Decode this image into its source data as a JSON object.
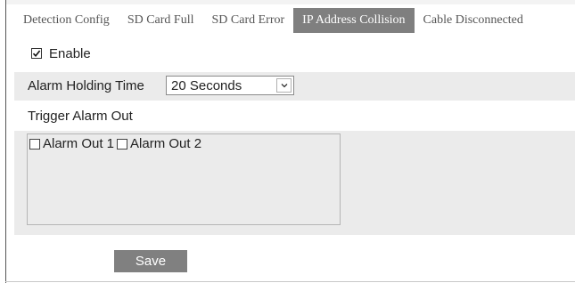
{
  "tabs": [
    {
      "label": "Detection Config",
      "active": false
    },
    {
      "label": "SD Card Full",
      "active": false
    },
    {
      "label": "SD Card Error",
      "active": false
    },
    {
      "label": "IP Address Collision",
      "active": true
    },
    {
      "label": "Cable Disconnected",
      "active": false
    }
  ],
  "enable": {
    "label": "Enable",
    "checked": true
  },
  "alarm_holding": {
    "label": "Alarm Holding Time",
    "selected": "20 Seconds"
  },
  "trigger_alarm_out": {
    "label": "Trigger Alarm Out",
    "items": [
      {
        "label": "Alarm Out 1",
        "checked": false
      },
      {
        "label": "Alarm Out 2",
        "checked": false
      }
    ]
  },
  "save": {
    "label": "Save"
  },
  "colors": {
    "active_tab": "#7f7f7f",
    "band": "#ebebeb",
    "button": "#808080"
  }
}
